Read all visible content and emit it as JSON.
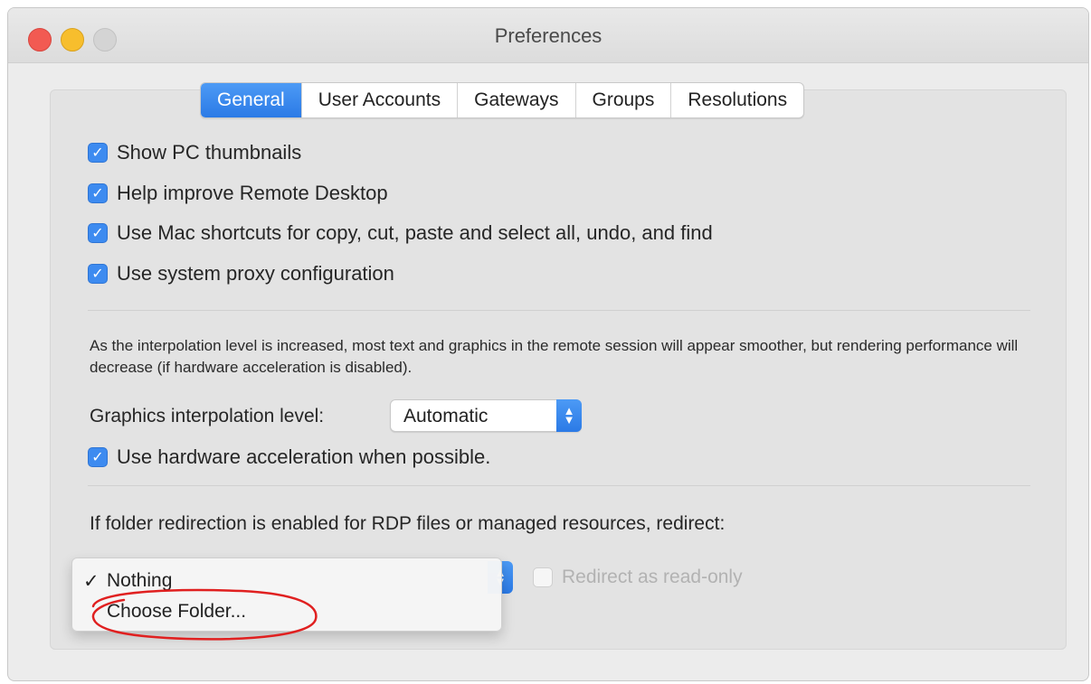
{
  "window": {
    "title": "Preferences"
  },
  "tabs": [
    {
      "label": "General",
      "active": true
    },
    {
      "label": "User Accounts",
      "active": false
    },
    {
      "label": "Gateways",
      "active": false
    },
    {
      "label": "Groups",
      "active": false
    },
    {
      "label": "Resolutions",
      "active": false
    }
  ],
  "general": {
    "checks": [
      {
        "label": "Show PC thumbnails",
        "checked": true
      },
      {
        "label": "Help improve Remote Desktop",
        "checked": true
      },
      {
        "label": "Use Mac shortcuts for copy, cut, paste and select all, undo, and find",
        "checked": true
      },
      {
        "label": "Use system proxy configuration",
        "checked": true
      }
    ],
    "interpolation_note": "As the interpolation level is increased, most text and graphics in the remote session will appear smoother, but rendering performance will decrease (if hardware acceleration is disabled).",
    "interpolation_label": "Graphics interpolation level:",
    "interpolation_value": "Automatic",
    "hw_accel": {
      "label": "Use hardware acceleration when possible.",
      "checked": true
    },
    "redirect_label": "If folder redirection is enabled for RDP files or managed resources, redirect:",
    "redirect_menu": [
      {
        "label": "Nothing",
        "checked": true
      },
      {
        "label": "Choose Folder...",
        "checked": false
      }
    ],
    "readonly": {
      "label": "Redirect as read-only",
      "checked": false,
      "enabled": false
    }
  },
  "colors": {
    "accent": "#2b7ae6",
    "annotation": "#e02020"
  }
}
